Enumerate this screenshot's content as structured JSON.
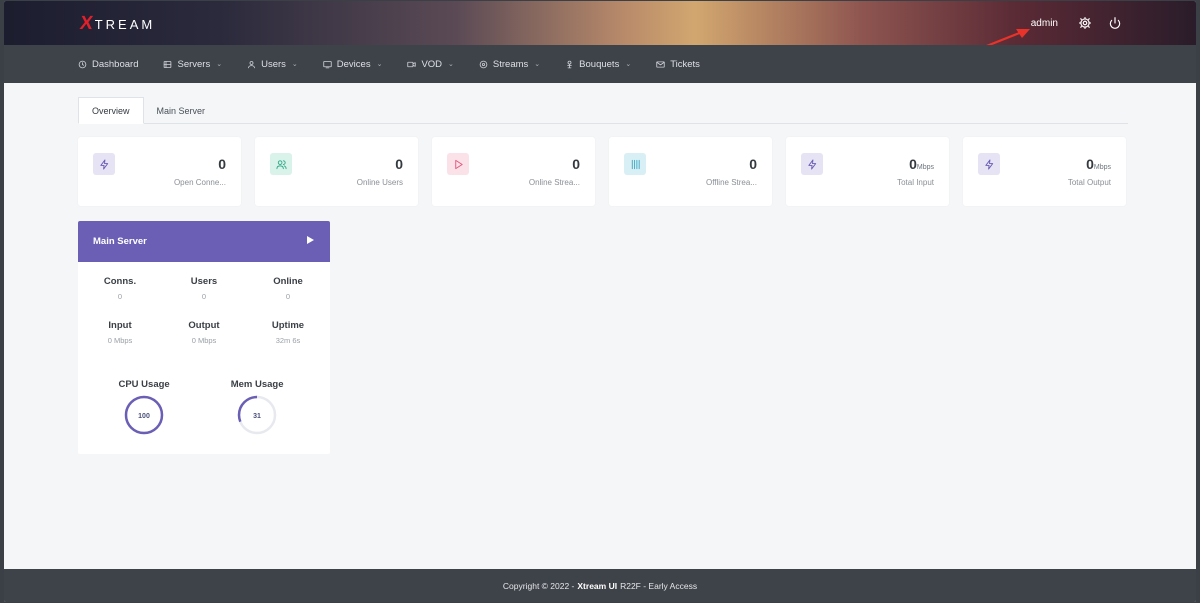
{
  "header": {
    "logo_x": "X",
    "logo_text": "TREAM",
    "user_label": "admin",
    "icons": [
      "gear-icon",
      "power-icon"
    ]
  },
  "nav": {
    "items": [
      {
        "label": "Dashboard",
        "icon": "clock-icon",
        "dropdown": false
      },
      {
        "label": "Servers",
        "icon": "server-icon",
        "dropdown": true
      },
      {
        "label": "Users",
        "icon": "user-icon",
        "dropdown": true
      },
      {
        "label": "Devices",
        "icon": "monitor-icon",
        "dropdown": true
      },
      {
        "label": "VOD",
        "icon": "video-icon",
        "dropdown": true
      },
      {
        "label": "Streams",
        "icon": "target-icon",
        "dropdown": true
      },
      {
        "label": "Bouquets",
        "icon": "bouquet-icon",
        "dropdown": true
      },
      {
        "label": "Tickets",
        "icon": "mail-icon",
        "dropdown": false
      }
    ],
    "chevron": "⌄"
  },
  "tabs": [
    {
      "label": "Overview",
      "active": true
    },
    {
      "label": "Main Server",
      "active": false
    }
  ],
  "stats": [
    {
      "value": "0",
      "unit": "",
      "label": "Open Conne...",
      "icon": "bolt-icon",
      "color": "#6a5fb5",
      "bg": "#e6e3f5"
    },
    {
      "value": "0",
      "unit": "",
      "label": "Online Users",
      "icon": "users-icon",
      "color": "#2fa886",
      "bg": "#d9f2ea"
    },
    {
      "value": "0",
      "unit": "",
      "label": "Online Strea...",
      "icon": "play-icon",
      "color": "#e0577f",
      "bg": "#fbe1e8"
    },
    {
      "value": "0",
      "unit": "",
      "label": "Offline Strea...",
      "icon": "columns-icon",
      "color": "#3aa8c4",
      "bg": "#d8eff5"
    },
    {
      "value": "0",
      "unit": "Mbps",
      "label": "Total Input",
      "icon": "bolt-icon",
      "color": "#6a5fb5",
      "bg": "#e6e3f5"
    },
    {
      "value": "0",
      "unit": "Mbps",
      "label": "Total Output",
      "icon": "bolt-icon",
      "color": "#6a5fb5",
      "bg": "#e6e3f5"
    }
  ],
  "server": {
    "title": "Main Server",
    "metrics": [
      {
        "label": "Conns.",
        "value": "0"
      },
      {
        "label": "Users",
        "value": "0"
      },
      {
        "label": "Online",
        "value": "0"
      },
      {
        "label": "Input",
        "value": "0 Mbps"
      },
      {
        "label": "Output",
        "value": "0 Mbps"
      },
      {
        "label": "Uptime",
        "value": "32m 6s"
      }
    ],
    "usage": [
      {
        "label": "CPU Usage",
        "value": 100
      },
      {
        "label": "Mem Usage",
        "value": 31
      }
    ]
  },
  "footer": {
    "prefix": "Copyright © 2022 -",
    "brand": "Xtream UI",
    "suffix": "R22F - Early Access"
  },
  "colors": {
    "accent": "#6a5fb5",
    "annotation_arrow": "#e8332a"
  }
}
